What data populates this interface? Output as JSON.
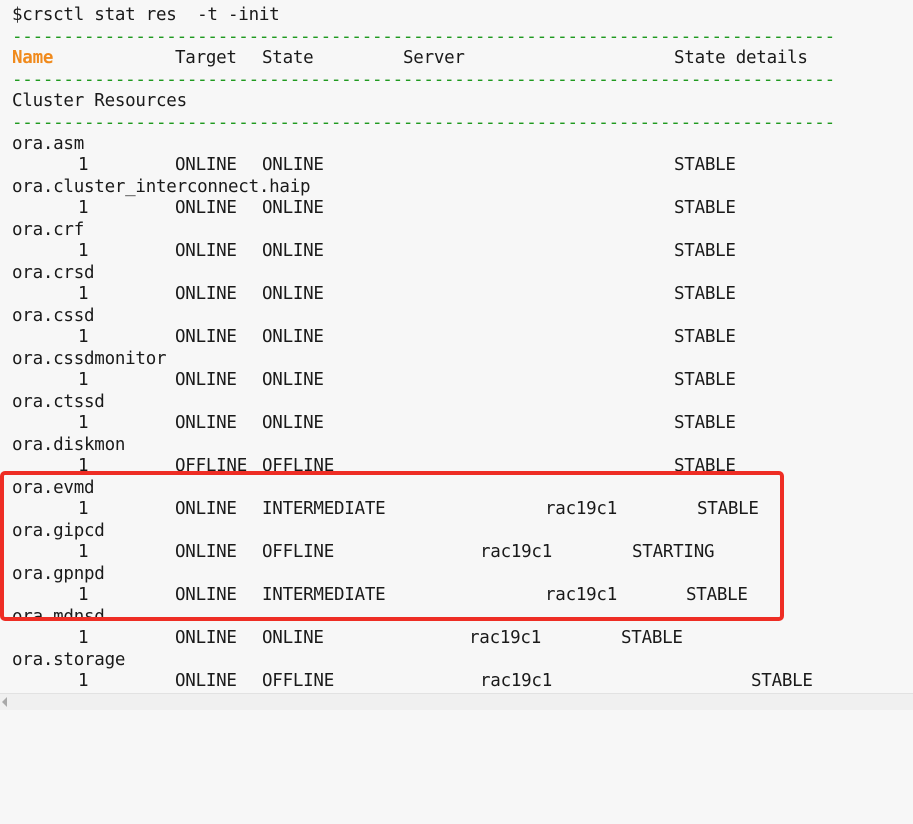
{
  "command": "$crsctl stat res  -t -init",
  "separator": "--------------------------------------------------------------------------------",
  "header": {
    "name": "Name",
    "target": "Target",
    "state": "State",
    "server": "Server",
    "state_details": "State details"
  },
  "section_title": "Cluster Resources",
  "rows": [
    {
      "name": "ora.asm",
      "num": "1",
      "target": "ONLINE",
      "state": "ONLINE",
      "server": "",
      "details": "STABLE"
    },
    {
      "name": "ora.cluster_interconnect.haip",
      "num": "1",
      "target": "ONLINE",
      "state": "ONLINE",
      "server": "",
      "details": "STABLE"
    },
    {
      "name": "ora.crf",
      "num": "1",
      "target": "ONLINE",
      "state": "ONLINE",
      "server": "",
      "details": "STABLE"
    },
    {
      "name": "ora.crsd",
      "num": "1",
      "target": "ONLINE",
      "state": "ONLINE",
      "server": "",
      "details": "STABLE"
    },
    {
      "name": "ora.cssd",
      "num": "1",
      "target": "ONLINE",
      "state": "ONLINE",
      "server": "",
      "details": "STABLE"
    },
    {
      "name": "ora.cssdmonitor",
      "num": "1",
      "target": "ONLINE",
      "state": "ONLINE",
      "server": "",
      "details": "STABLE"
    },
    {
      "name": "ora.ctssd",
      "num": "1",
      "target": "ONLINE",
      "state": "ONLINE",
      "server": "",
      "details": "STABLE"
    },
    {
      "name": "ora.diskmon",
      "num": "1",
      "target": "OFFLINE",
      "state": "OFFLINE",
      "server": "",
      "details": "STABLE"
    },
    {
      "name": "ora.evmd",
      "num": "1",
      "target": "ONLINE",
      "state": "INTERMEDIATE",
      "server": "rac19c1",
      "details": "STABLE"
    },
    {
      "name": "ora.gipcd",
      "num": "1",
      "target": "ONLINE",
      "state": "OFFLINE",
      "server": "rac19c1",
      "details": "STARTING"
    },
    {
      "name": "ora.gpnpd",
      "num": "1",
      "target": "ONLINE",
      "state": "INTERMEDIATE",
      "server": "rac19c1",
      "details": "STABLE"
    },
    {
      "name": "ora.mdnsd",
      "num": "1",
      "target": "ONLINE",
      "state": "ONLINE",
      "server": "rac19c1",
      "details": "STABLE"
    },
    {
      "name": "ora.storage",
      "num": "1",
      "target": "ONLINE",
      "state": "OFFLINE",
      "server": "rac19c1",
      "details": "STABLE"
    }
  ],
  "highlight_color": "#ee2d24",
  "separator_color": "#1f9a1f",
  "header_name_color": "#f08a1c"
}
